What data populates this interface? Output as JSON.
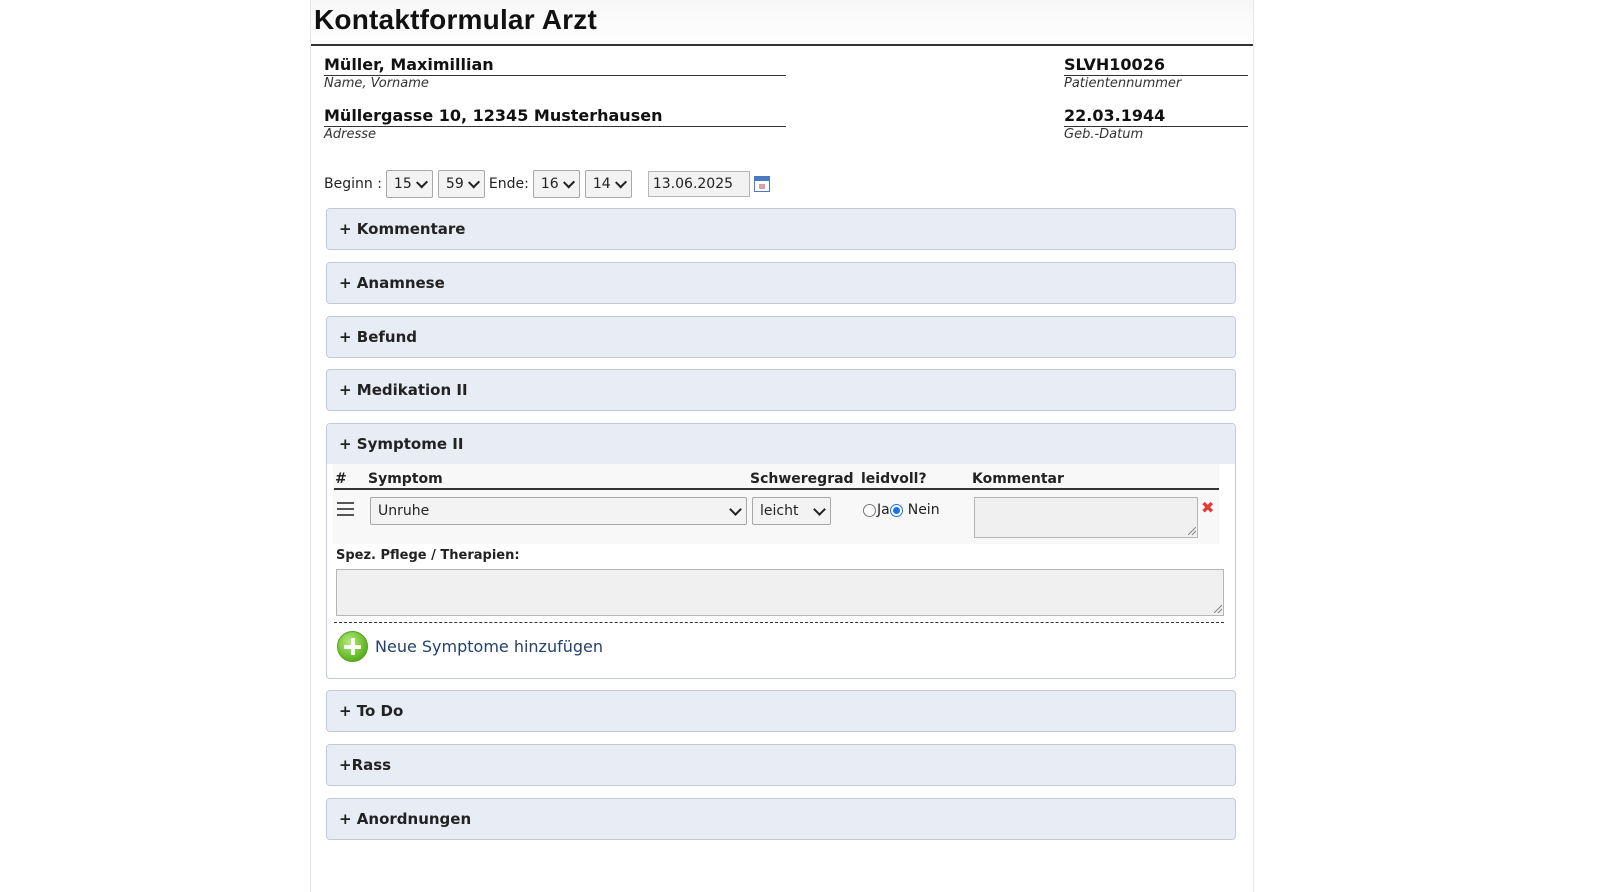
{
  "form": {
    "title": "Kontaktformular Arzt"
  },
  "patient": {
    "name": {
      "value": "Müller, Maximillian",
      "label": "Name, Vorname"
    },
    "id": {
      "value": "SLVH10026",
      "label": "Patientennummer"
    },
    "address": {
      "value": "Müllergasse 10, 12345 Musterhausen",
      "label": "Adresse"
    },
    "dob": {
      "value": "22.03.1944",
      "label": "Geb.-Datum"
    }
  },
  "time": {
    "begin_label": "Beginn :",
    "begin_hour": "15",
    "begin_minute": "59",
    "end_label": "Ende:",
    "end_hour": "16",
    "end_minute": "14",
    "date": "13.06.2025"
  },
  "sections": {
    "kommentare": "+ Kommentare",
    "anamnese": "+ Anamnese",
    "befund": "+ Befund",
    "medikation": "+ Medikation II",
    "symptome": "+ Symptome II",
    "todo": "+ To Do",
    "rass": "+Rass",
    "anordnungen": "+ Anordnungen"
  },
  "symptoms": {
    "columns": {
      "num": "#",
      "symptom": "Symptom",
      "severity": "Schweregrad",
      "distress": "leidvoll?",
      "comment": "Kommentar"
    },
    "row": {
      "symptom": "Unruhe",
      "severity": "leicht",
      "yes_label": "Ja",
      "no_label": "Nein",
      "selected": "Nein",
      "comment": ""
    },
    "care_label": "Spez. Pflege / Therapien:",
    "care_value": "",
    "add_label": "Neue Symptome hinzufügen"
  },
  "colors": {
    "accordion_bg": "#e8edf5",
    "accordion_border": "#c2cad6",
    "link": "#23406e",
    "delete": "#e03c3c",
    "add": "#5bb31f"
  },
  "icons": {
    "drag": "hamburger-icon",
    "delete": "close-icon",
    "add": "plus-circle-icon",
    "calendar": "calendar-icon"
  }
}
